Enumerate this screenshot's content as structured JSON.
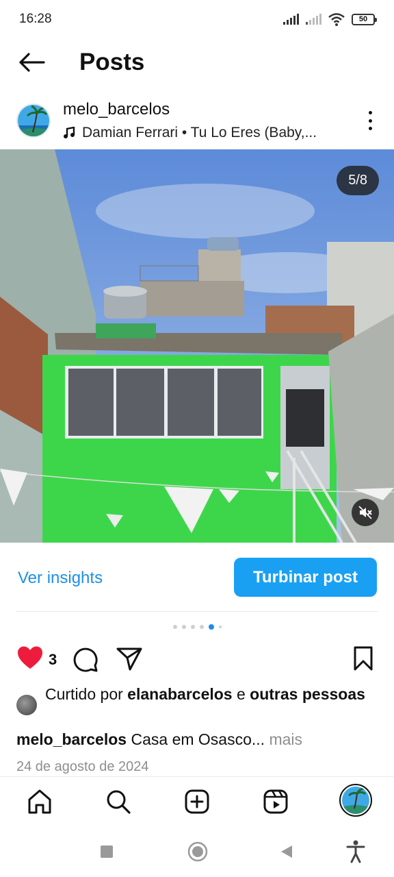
{
  "status_bar": {
    "time": "16:28",
    "battery": "50"
  },
  "header": {
    "title": "Posts"
  },
  "post": {
    "username": "melo_barcelos",
    "music": "Damian Ferrari • Tu Lo Eres (Baby,...",
    "image_counter": "5/8"
  },
  "insights": {
    "ver_insights": "Ver insights",
    "turbinar": "Turbinar post"
  },
  "carousel": {
    "total": 6,
    "active_index": 4
  },
  "actions": {
    "like_count": "3"
  },
  "likes": {
    "prefix": "Curtido por",
    "user": "elanabarcelos",
    "conj": "e",
    "others": "outras pessoas"
  },
  "caption": {
    "user": "melo_barcelos",
    "text": "Casa em Osasco...",
    "more": "mais"
  },
  "date": "24 de agosto de 2024",
  "colors": {
    "accent": "#1aa0f2",
    "like": "#ed1c3c",
    "link": "#1e90e6"
  }
}
